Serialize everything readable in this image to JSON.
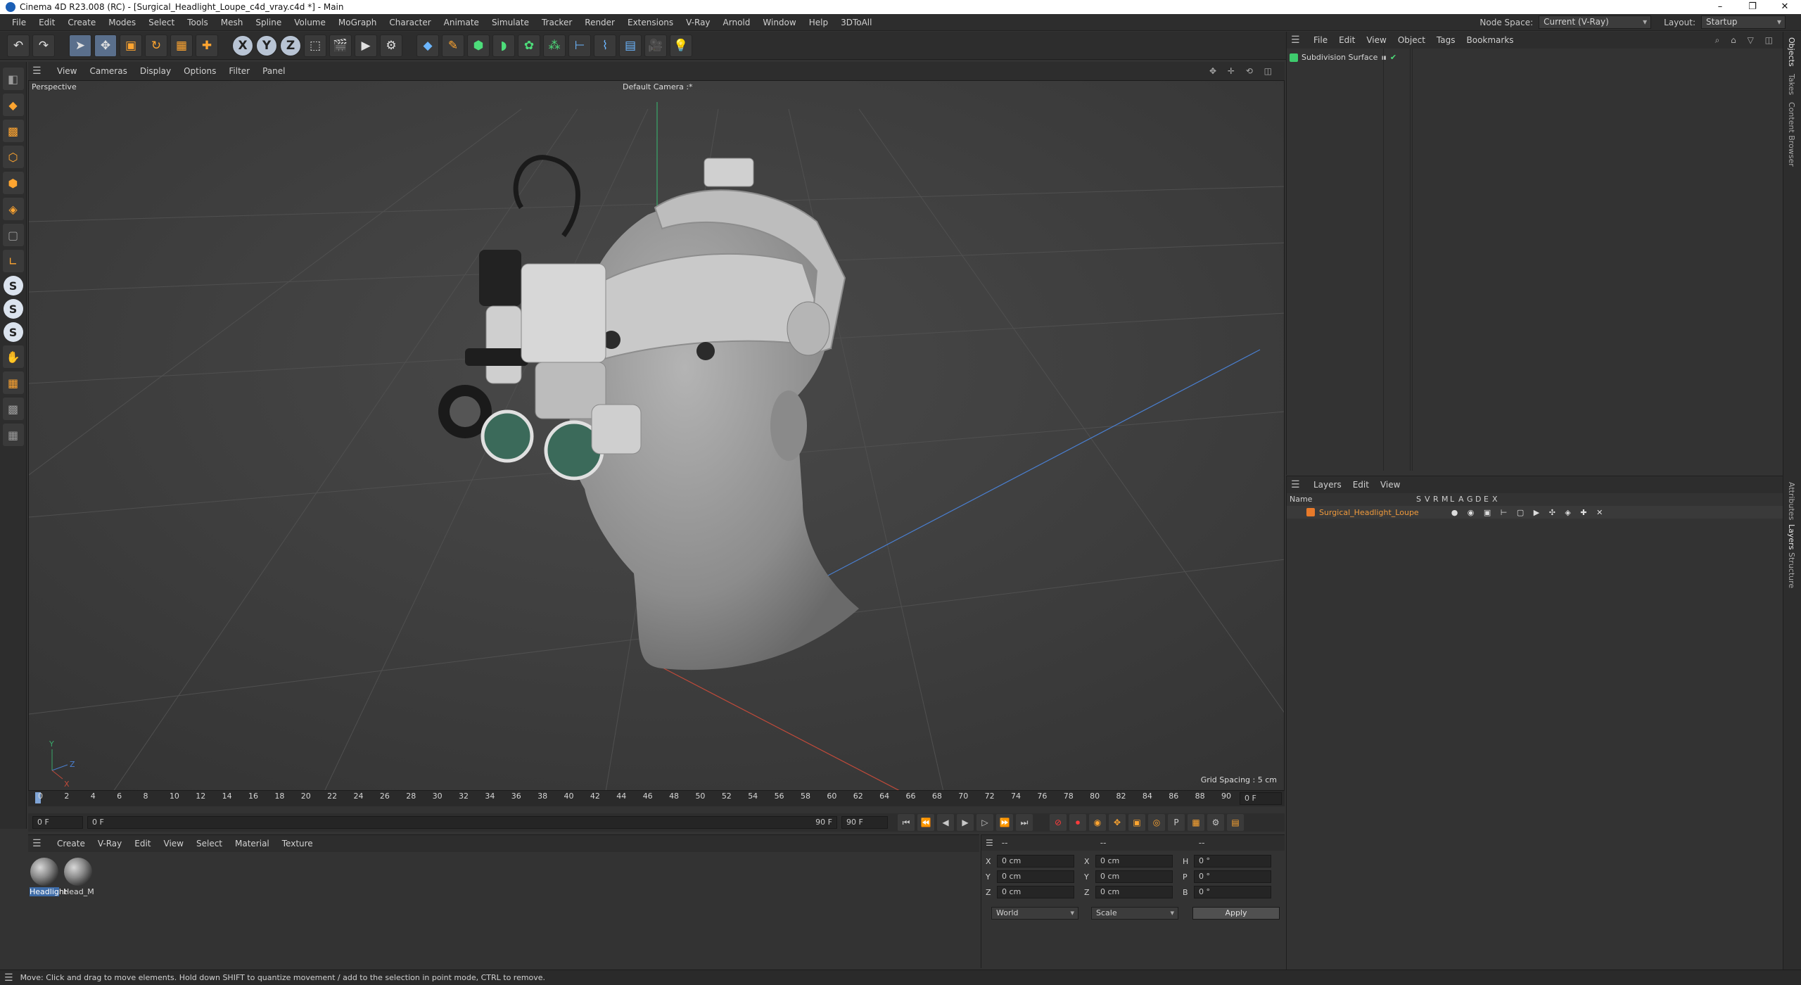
{
  "window": {
    "title": "Cinema 4D R23.008 (RC) - [Surgical_Headlight_Loupe_c4d_vray.c4d *] - Main",
    "controls": [
      "–",
      "❐",
      "✕"
    ]
  },
  "menubar": {
    "items": [
      "File",
      "Edit",
      "Create",
      "Modes",
      "Select",
      "Tools",
      "Mesh",
      "Spline",
      "Volume",
      "MoGraph",
      "Character",
      "Animate",
      "Simulate",
      "Tracker",
      "Render",
      "Extensions",
      "V-Ray",
      "Arnold",
      "Window",
      "Help",
      "3DToAll"
    ],
    "node_space_label": "Node Space:",
    "node_space_value": "Current (V-Ray)",
    "layout_label": "Layout:",
    "layout_value": "Startup"
  },
  "toolbar": {
    "icons": [
      {
        "name": "undo-icon",
        "glyph": "↶"
      },
      {
        "name": "redo-icon",
        "glyph": "↷"
      },
      {
        "name": "select-icon",
        "glyph": "➤",
        "active": true
      },
      {
        "name": "move-icon",
        "glyph": "✥",
        "active": true
      },
      {
        "name": "scale-icon",
        "glyph": "▣"
      },
      {
        "name": "rotate-icon",
        "glyph": "↻"
      },
      {
        "name": "recent-tool-icon",
        "glyph": "▦"
      },
      {
        "name": "add-icon",
        "glyph": "✚"
      }
    ],
    "axes": [
      "X",
      "Y",
      "Z"
    ],
    "render_icons": [
      {
        "name": "coordinate-system-icon",
        "glyph": "⬚"
      },
      {
        "name": "render-region-icon",
        "glyph": "🎬"
      },
      {
        "name": "render-view-icon",
        "glyph": "▶"
      },
      {
        "name": "render-settings-icon",
        "glyph": "⚙"
      }
    ],
    "object_icons": [
      {
        "name": "cube-icon",
        "glyph": "◆",
        "color": "blue"
      },
      {
        "name": "pen-icon",
        "glyph": "✎",
        "color": "orange"
      },
      {
        "name": "subdivision-icon",
        "glyph": "⬢",
        "color": "green"
      },
      {
        "name": "bend-icon",
        "glyph": "◗",
        "color": "green"
      },
      {
        "name": "cloner-icon",
        "glyph": "✿",
        "color": "green"
      },
      {
        "name": "mograph-icon",
        "glyph": "⁂",
        "color": "green"
      },
      {
        "name": "field-icon",
        "glyph": "⊢",
        "color": "blue"
      },
      {
        "name": "deformer-icon",
        "glyph": "⌇",
        "color": "blue"
      },
      {
        "name": "floor-icon",
        "glyph": "▤",
        "color": "blue"
      },
      {
        "name": "camera-icon",
        "glyph": "🎥",
        "color": "grey"
      },
      {
        "name": "light-icon",
        "glyph": "💡",
        "color": "grey"
      }
    ]
  },
  "left_tools": [
    {
      "name": "make-editable-icon",
      "glyph": "◧",
      "style": "grey"
    },
    {
      "name": "model-mode-icon",
      "glyph": "◆",
      "style": "orange"
    },
    {
      "name": "texture-mode-icon",
      "glyph": "▩",
      "style": "orange"
    },
    {
      "name": "points-mode-icon",
      "glyph": "⬡",
      "style": "orange"
    },
    {
      "name": "edges-mode-icon",
      "glyph": "⬢",
      "style": "orange"
    },
    {
      "name": "polygons-mode-icon",
      "glyph": "◈",
      "style": "orange"
    },
    {
      "name": "uv-mode-icon",
      "glyph": "▢",
      "style": "grey"
    },
    {
      "name": "axis-mode-icon",
      "glyph": "∟",
      "style": "orange"
    },
    {
      "name": "snap-icon",
      "glyph": "S",
      "style": "s"
    },
    {
      "name": "snap-settings-icon",
      "glyph": "S",
      "style": "s"
    },
    {
      "name": "workplane-icon",
      "glyph": "S",
      "style": "s"
    },
    {
      "name": "soft-selection-icon",
      "glyph": "✋",
      "style": "orange"
    },
    {
      "name": "grid-icon",
      "glyph": "▦",
      "style": "orange"
    },
    {
      "name": "workplane-grid-icon",
      "glyph": "▩",
      "style": "grey"
    },
    {
      "name": "lock-grid-icon",
      "glyph": "▦",
      "style": "grey"
    }
  ],
  "viewport": {
    "menu": [
      "View",
      "Cameras",
      "Display",
      "Options",
      "Filter",
      "Panel"
    ],
    "view_name": "Perspective",
    "camera_name": "Default Camera :*",
    "grid_spacing": "Grid Spacing : 5 cm",
    "nav_icons": "✥ ✛ ⟲ ◫"
  },
  "timeline": {
    "ticks": [
      "0",
      "2",
      "4",
      "6",
      "8",
      "10",
      "12",
      "14",
      "16",
      "18",
      "20",
      "22",
      "24",
      "26",
      "28",
      "30",
      "32",
      "34",
      "36",
      "38",
      "40",
      "42",
      "44",
      "46",
      "48",
      "50",
      "52",
      "54",
      "56",
      "58",
      "60",
      "62",
      "64",
      "66",
      "68",
      "70",
      "72",
      "74",
      "76",
      "78",
      "80",
      "82",
      "84",
      "86",
      "88",
      "90"
    ],
    "end_field": "0 F",
    "current_frame": 0,
    "total_frames": 90
  },
  "transport": {
    "start": "0 F",
    "preview_start": "0 F",
    "preview_end": "90 F",
    "end": "90 F",
    "buttons": [
      {
        "name": "goto-start-icon",
        "glyph": "⏮"
      },
      {
        "name": "prev-key-icon",
        "glyph": "⏪"
      },
      {
        "name": "prev-frame-icon",
        "glyph": "◀"
      },
      {
        "name": "play-icon",
        "glyph": "▶"
      },
      {
        "name": "next-frame-icon",
        "glyph": "▷"
      },
      {
        "name": "next-key-icon",
        "glyph": "⏩"
      },
      {
        "name": "goto-end-icon",
        "glyph": "⏭"
      }
    ],
    "key_buttons": [
      {
        "name": "record-off-icon",
        "glyph": "⊘",
        "style": "rec"
      },
      {
        "name": "record-icon",
        "glyph": "⏺",
        "style": "rec"
      },
      {
        "name": "autokey-icon",
        "glyph": "◉",
        "style": "orange"
      },
      {
        "name": "key-move-icon",
        "glyph": "✥",
        "style": "orange"
      },
      {
        "name": "key-scale-icon",
        "glyph": "▣",
        "style": "orange"
      },
      {
        "name": "key-rotate-icon",
        "glyph": "◎",
        "style": "orange"
      },
      {
        "name": "key-param-icon",
        "glyph": "P",
        "style": "normal"
      },
      {
        "name": "key-pla-icon",
        "glyph": "▦",
        "style": "orange"
      },
      {
        "name": "motion-icon",
        "glyph": "⚙",
        "style": "normal"
      },
      {
        "name": "timeline-icon",
        "glyph": "▤",
        "style": "orange"
      }
    ]
  },
  "materials": {
    "menu": [
      "Create",
      "V-Ray",
      "Edit",
      "View",
      "Select",
      "Material",
      "Texture"
    ],
    "items": [
      {
        "label": "Headlight",
        "selected": true
      },
      {
        "label": "Head_M",
        "selected": false
      }
    ]
  },
  "coordinates": {
    "header": [
      "--",
      "--",
      "--"
    ],
    "rows": [
      {
        "pos_axis": "X",
        "pos": "0 cm",
        "size_axis": "X",
        "size": "0 cm",
        "rot_axis": "H",
        "rot": "0 °"
      },
      {
        "pos_axis": "Y",
        "pos": "0 cm",
        "size_axis": "Y",
        "size": "0 cm",
        "rot_axis": "P",
        "rot": "0 °"
      },
      {
        "pos_axis": "Z",
        "pos": "0 cm",
        "size_axis": "Z",
        "size": "0 cm",
        "rot_axis": "B",
        "rot": "0 °"
      }
    ],
    "space": "World",
    "mode": "Scale",
    "apply": "Apply"
  },
  "objects": {
    "menu": [
      "File",
      "Edit",
      "View",
      "Object",
      "Tags",
      "Bookmarks"
    ],
    "items": [
      {
        "name": "Subdivision Surface"
      }
    ]
  },
  "layers": {
    "menu": [
      "Layers",
      "Edit",
      "View"
    ],
    "columns": [
      "Name",
      "S",
      "V",
      "R",
      "M",
      "L",
      "A",
      "G",
      "D",
      "E",
      "X"
    ],
    "items": [
      {
        "name": "Surgical_Headlight_Loupe",
        "color": "#e87a2a"
      }
    ]
  },
  "side_tabs": [
    "Objects",
    "Takes",
    "Content Browser",
    "Attributes",
    "Layers",
    "Structure"
  ],
  "status": {
    "message": "Move: Click and drag to move elements. Hold down SHIFT to quantize movement / add to the selection in point mode, CTRL to remove."
  }
}
